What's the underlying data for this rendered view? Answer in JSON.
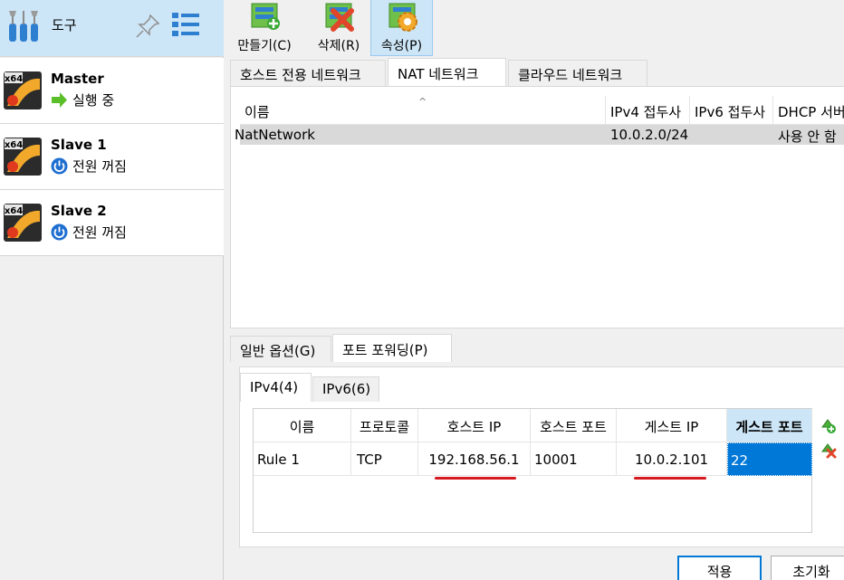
{
  "sidebar": {
    "tools_label": "도구",
    "vms": [
      {
        "name": "Master",
        "state": "실행 중",
        "state_icon": "running-arrow-icon",
        "os_badge": "x64"
      },
      {
        "name": "Slave 1",
        "state": "전원 꺼짐",
        "state_icon": "power-off-icon",
        "os_badge": "x64"
      },
      {
        "name": "Slave 2",
        "state": "전원 꺼짐",
        "state_icon": "power-off-icon",
        "os_badge": "x64"
      }
    ]
  },
  "toolbar": {
    "create_label": "만들기(C)",
    "delete_label": "삭제(R)",
    "properties_label": "속성(P)"
  },
  "network_tabs": [
    "호스트 전용 네트워크",
    "NAT 네트워크",
    "클라우드 네트워크"
  ],
  "network_table": {
    "columns": [
      "이름",
      "IPv4 접두사",
      "IPv6 접두사",
      "DHCP 서버"
    ],
    "rows": [
      {
        "name": "NatNetwork",
        "ipv4": "10.0.2.0/24",
        "ipv6": "",
        "dhcp": "사용 안 함"
      }
    ]
  },
  "option_tabs": [
    "일반 옵션(G)",
    "포트 포워딩(P)"
  ],
  "port_forwarding": {
    "sub_tabs": [
      "IPv4(4)",
      "IPv6(6)"
    ],
    "columns": [
      "이름",
      "프로토콜",
      "호스트 IP",
      "호스트 포트",
      "게스트 IP",
      "게스트 포트"
    ],
    "rows": [
      {
        "name": "Rule 1",
        "protocol": "TCP",
        "host_ip": "192.168.56.1",
        "host_port": "10001",
        "guest_ip": "10.0.2.101",
        "guest_port": "22"
      }
    ]
  },
  "buttons": {
    "apply": "적용",
    "reset": "초기화"
  },
  "colors": {
    "selection_blue": "#0078d7",
    "header_highlight": "#cde6f7",
    "annotation_red": "#d71920"
  }
}
